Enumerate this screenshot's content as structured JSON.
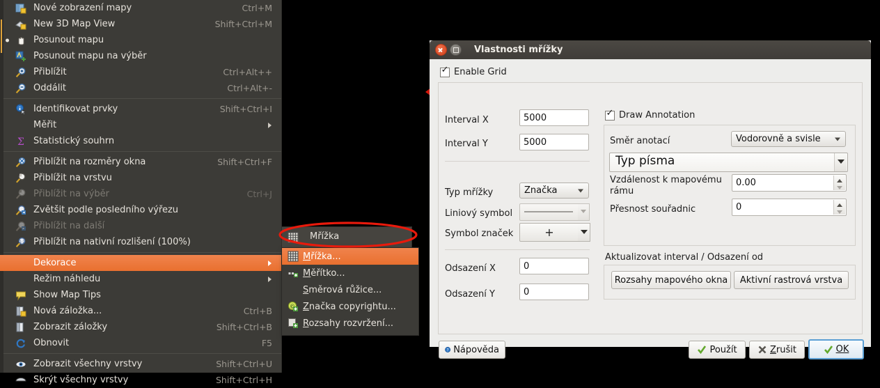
{
  "menu": {
    "items": [
      {
        "label": "Nové zobrazení mapy",
        "accel": "Ctrl+M",
        "icon": "new-map-view-icon",
        "state": "normal"
      },
      {
        "label": "New 3D Map View",
        "accel": "Shift+Ctrl+M",
        "icon": "new-3d-map-view-icon",
        "state": "normal"
      },
      {
        "label": "Posunout mapu",
        "accel": "",
        "icon": "pan-map-icon",
        "state": "checked"
      },
      {
        "label": "Posunout mapu na výběr",
        "accel": "",
        "icon": "pan-to-selection-icon",
        "state": "normal"
      },
      {
        "label": "Přiblížit",
        "accel": "Ctrl+Alt++",
        "icon": "zoom-in-icon",
        "state": "normal"
      },
      {
        "label": "Oddálit",
        "accel": "Ctrl+Alt+-",
        "icon": "zoom-out-icon",
        "state": "normal"
      },
      {
        "separator": true
      },
      {
        "label": "Identifikovat prvky",
        "accel": "Shift+Ctrl+I",
        "icon": "identify-features-icon",
        "state": "normal"
      },
      {
        "label": "Měřit",
        "accel": "",
        "icon": "",
        "state": "submenu"
      },
      {
        "label": "Statistický souhrn",
        "accel": "",
        "icon": "statistics-icon",
        "state": "normal"
      },
      {
        "separator": true
      },
      {
        "label": "Přiblížit na rozměry okna",
        "accel": "Shift+Ctrl+F",
        "icon": "zoom-full-icon",
        "state": "normal"
      },
      {
        "label": "Přiblížit na vrstvu",
        "accel": "",
        "icon": "zoom-to-layer-icon",
        "state": "normal"
      },
      {
        "label": "Přiblížit na výběr",
        "accel": "Ctrl+J",
        "icon": "zoom-to-selection-icon",
        "state": "disabled"
      },
      {
        "label": "Zvětšit podle posledního výřezu",
        "accel": "",
        "icon": "zoom-last-icon",
        "state": "normal"
      },
      {
        "label": "Přiblížit na další",
        "accel": "",
        "icon": "zoom-next-icon",
        "state": "disabled"
      },
      {
        "label": "Přiblížit na nativní rozlišení (100%)",
        "accel": "",
        "icon": "zoom-native-icon",
        "state": "normal"
      },
      {
        "separator": true
      },
      {
        "label": "Dekorace",
        "accel": "",
        "icon": "",
        "state": "highlighted-submenu"
      },
      {
        "label": "Režim náhledu",
        "accel": "",
        "icon": "",
        "state": "submenu"
      },
      {
        "label": "Show Map Tips",
        "accel": "",
        "icon": "map-tips-icon",
        "state": "normal"
      },
      {
        "label": "Nová záložka...",
        "accel": "Ctrl+B",
        "icon": "new-bookmark-icon",
        "state": "normal"
      },
      {
        "label": "Zobrazit záložky",
        "accel": "Shift+Ctrl+B",
        "icon": "show-bookmarks-icon",
        "state": "normal"
      },
      {
        "label": "Obnovit",
        "accel": "F5",
        "icon": "refresh-icon",
        "state": "normal"
      },
      {
        "separator": true
      },
      {
        "label": "Zobrazit všechny vrstvy",
        "accel": "Shift+Ctrl+U",
        "icon": "show-all-layers-icon",
        "state": "normal"
      },
      {
        "label": "Skrýt všechny vrstvy",
        "accel": "Shift+Ctrl+H",
        "icon": "hide-all-layers-icon",
        "state": "normal"
      }
    ]
  },
  "ghost_row": {
    "label": "Mřížka",
    "icon": "grid-icon"
  },
  "submenu": {
    "items": [
      {
        "label": "Mřížka...",
        "mnemonic": "M",
        "icon": "grid-icon",
        "highlighted": true
      },
      {
        "label": "Měřítko...",
        "mnemonic": "M",
        "icon": "scalebar-icon",
        "highlighted": false
      },
      {
        "label": "Směrová růžice...",
        "mnemonic": "S",
        "icon": "",
        "highlighted": false
      },
      {
        "label": "Značka copyrightu...",
        "mnemonic": "Z",
        "icon": "copyright-icon",
        "highlighted": false
      },
      {
        "label": "Rozsahy rozvržení...",
        "mnemonic": "R",
        "icon": "layout-extents-icon",
        "highlighted": false
      }
    ]
  },
  "dialog": {
    "title": "Vlastnosti mřížky",
    "window_buttons": {
      "close": "close-icon",
      "maximize": "maximize-icon"
    },
    "enable_grid": {
      "label": "Enable Grid",
      "checked": true
    },
    "left": {
      "interval_x": {
        "label": "Interval X",
        "value": "5000"
      },
      "interval_y": {
        "label": "Interval Y",
        "value": "5000"
      },
      "grid_type": {
        "label": "Typ mřížky",
        "value": "Značka"
      },
      "line_symbol": {
        "label": "Liniový symbol",
        "value": "line-preview"
      },
      "marker_symbol": {
        "label": "Symbol značek",
        "value": "+"
      },
      "offset_x": {
        "label": "Odsazení X",
        "value": "0"
      },
      "offset_y": {
        "label": "Odsazení Y",
        "value": "0"
      }
    },
    "right": {
      "draw_annotation": {
        "label": "Draw Annotation",
        "checked": true
      },
      "annotation_direction": {
        "label": "Směr anotací",
        "value": "Vodorovně a svisle"
      },
      "font_type": {
        "value": "Typ písma"
      },
      "frame_distance": {
        "label": "Vzdálenost k mapovému rámu",
        "value": "0.00"
      },
      "coord_precision": {
        "label": "Přesnost souřadnic",
        "value": "0"
      },
      "update_group": {
        "label": "Aktualizovat interval / Odsazení od",
        "buttons": [
          "Rozsahy mapového okna",
          "Aktivní rastrová vrstva"
        ]
      }
    },
    "footer": {
      "help": "Nápověda",
      "apply": "Použít",
      "cancel": "Zrušit",
      "ok": "OK"
    }
  },
  "colors": {
    "menu_bg": "#3c3b37",
    "highlight": "#e9702f",
    "dialog_bg": "#ededeb",
    "annotation_red": "#e81a0c"
  }
}
